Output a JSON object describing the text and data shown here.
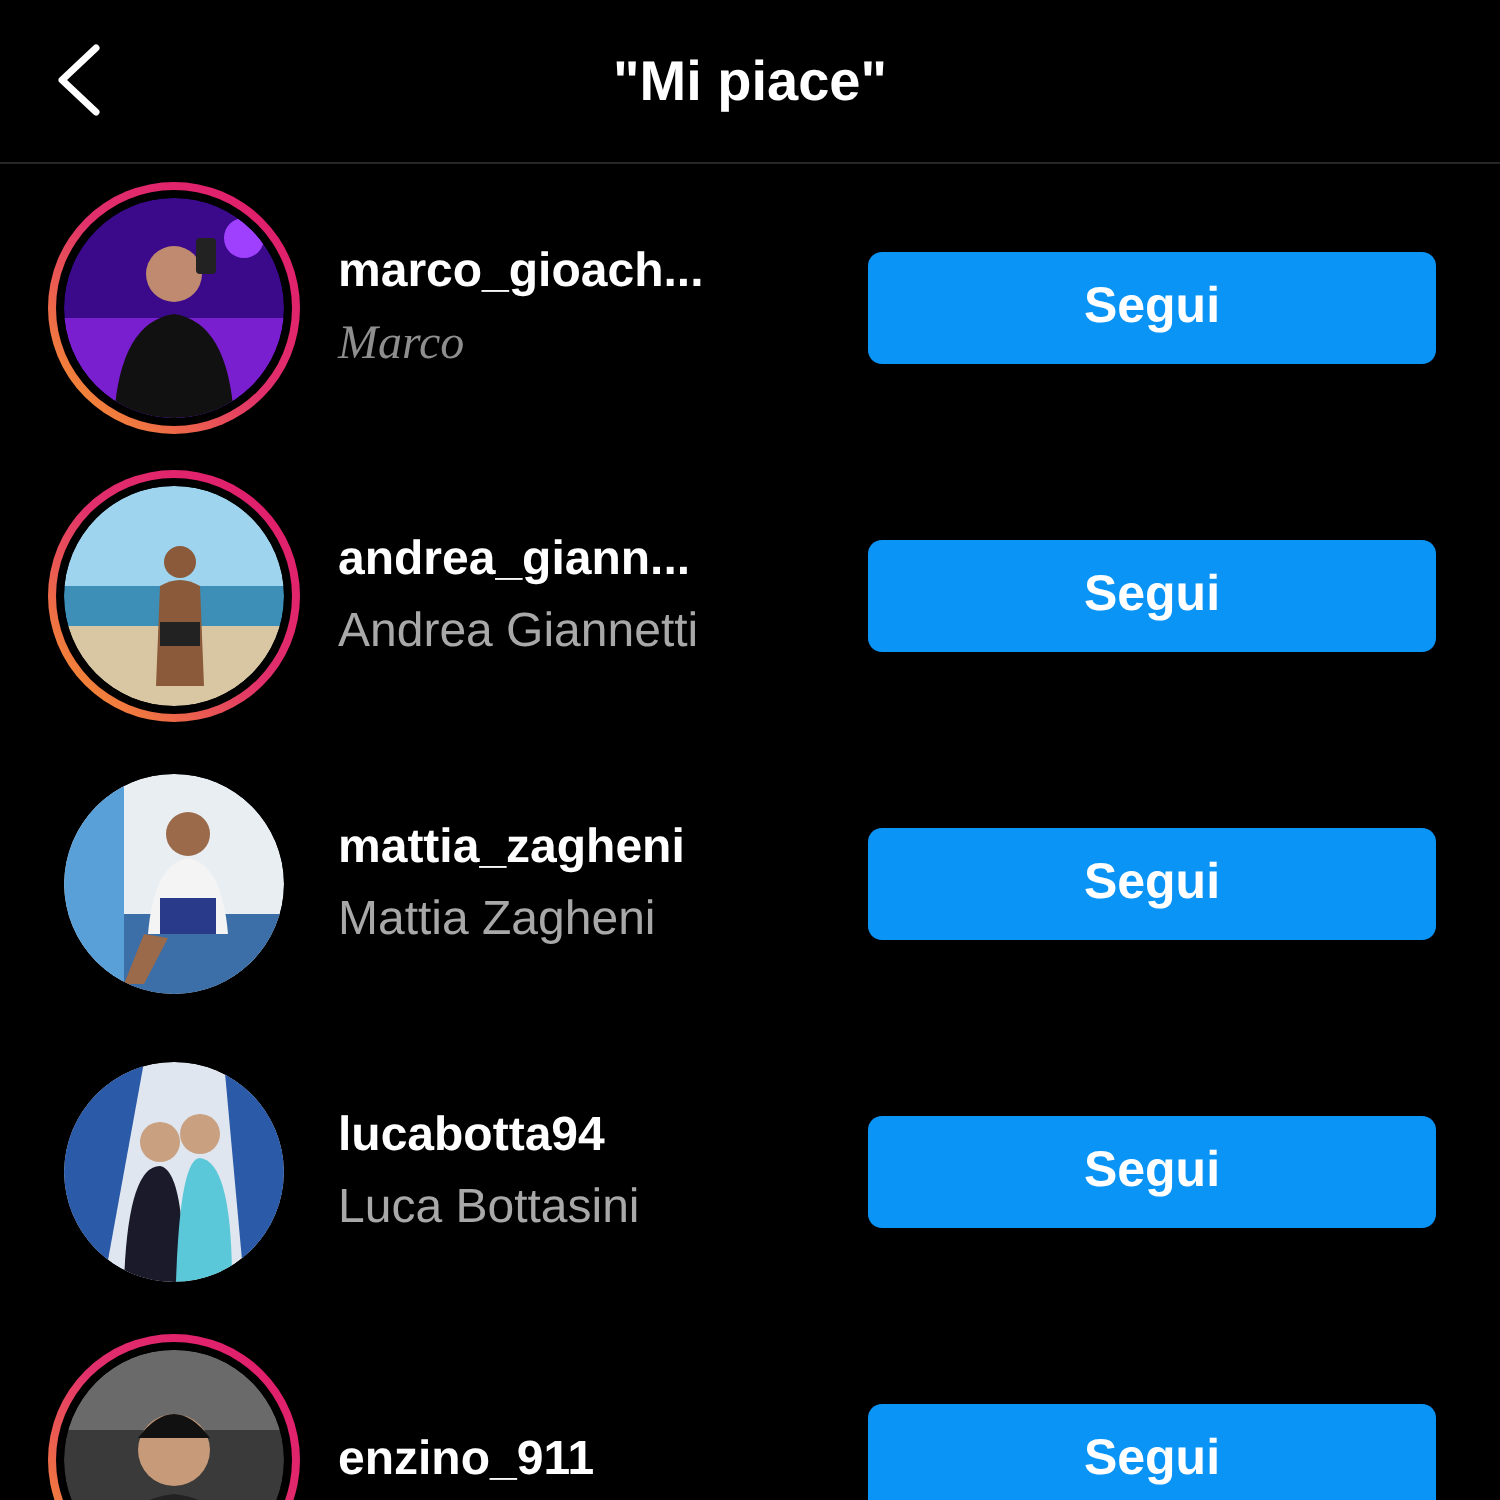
{
  "header": {
    "title": "\"Mi piace\""
  },
  "users": [
    {
      "username": "marco_gioach...",
      "name": "Marco",
      "story": true,
      "fancy_name": true,
      "button": "Segui"
    },
    {
      "username": "andrea_giann...",
      "name": "Andrea Giannetti",
      "story": true,
      "fancy_name": false,
      "button": "Segui"
    },
    {
      "username": "mattia_zagheni",
      "name": "Mattia Zagheni",
      "story": false,
      "fancy_name": false,
      "button": "Segui"
    },
    {
      "username": "lucabotta94",
      "name": "Luca Bottasini",
      "story": false,
      "fancy_name": false,
      "button": "Segui"
    },
    {
      "username": "enzino_911",
      "story": true,
      "button": "Segui"
    }
  ]
}
